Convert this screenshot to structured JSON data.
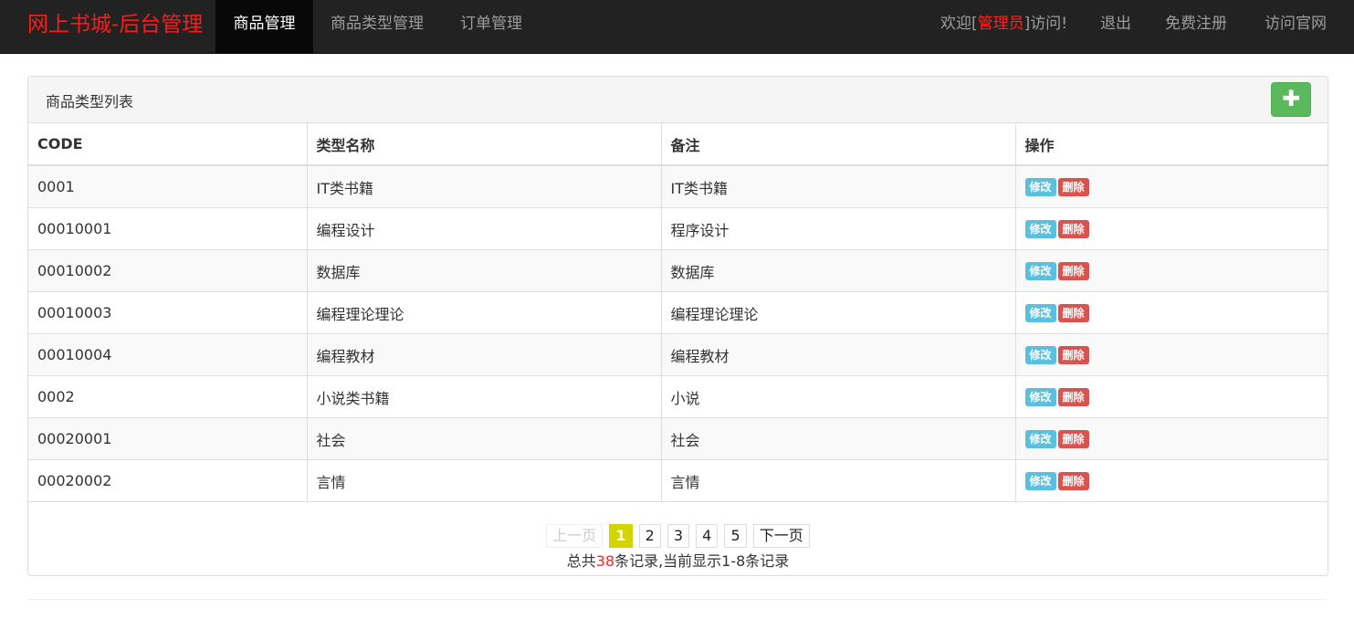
{
  "navbar": {
    "brand": "网上书城-后台管理",
    "items": [
      {
        "label": "商品管理",
        "active": true
      },
      {
        "label": "商品类型管理",
        "active": false
      },
      {
        "label": "订单管理",
        "active": false
      }
    ],
    "welcome_prefix": "欢迎[",
    "welcome_user": "管理员",
    "welcome_suffix": "]访问!",
    "logout": "退出",
    "register": "免费注册",
    "official_site": "访问官网"
  },
  "panel": {
    "title": "商品类型列表",
    "add_icon": "plus-icon",
    "add_symbol": "✚"
  },
  "table": {
    "headers": [
      "CODE",
      "类型名称",
      "备注",
      "操作"
    ],
    "rows": [
      {
        "code": "0001",
        "name": "IT类书籍",
        "remark": "IT类书籍"
      },
      {
        "code": "00010001",
        "name": "编程设计",
        "remark": "程序设计"
      },
      {
        "code": "00010002",
        "name": "数据库",
        "remark": "数据库"
      },
      {
        "code": "00010003",
        "name": "编程理论理论",
        "remark": "编程理论理论"
      },
      {
        "code": "00010004",
        "name": "编程教材",
        "remark": "编程教材"
      },
      {
        "code": "0002",
        "name": "小说类书籍",
        "remark": "小说"
      },
      {
        "code": "00020001",
        "name": "社会",
        "remark": "社会"
      },
      {
        "code": "00020002",
        "name": "言情",
        "remark": "言情"
      }
    ],
    "edit_label": "修改",
    "delete_label": "删除"
  },
  "pagination": {
    "prev": "上一页",
    "pages": [
      "1",
      "2",
      "3",
      "4",
      "5"
    ],
    "current": "1",
    "next": "下一页",
    "summary_prefix": "总共",
    "total": "38",
    "summary_suffix": "条记录,当前显示1-8条记录"
  },
  "colors": {
    "brand": "#ff1a1a",
    "navbar_bg": "#222222",
    "add_button": "#5cb85c",
    "edit_button": "#5bc0de",
    "delete_button": "#d9534f",
    "current_page": "#d4d400"
  }
}
